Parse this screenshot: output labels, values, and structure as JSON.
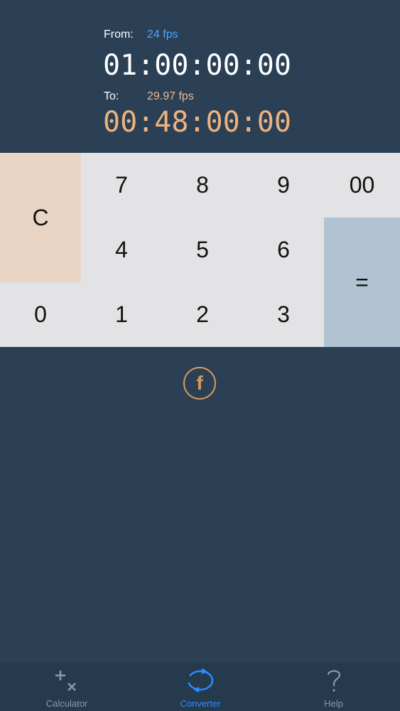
{
  "header": {
    "from_label": "From:",
    "from_fps": "24 fps",
    "from_timecode": "01:00:00:00",
    "to_label": "To:",
    "to_fps": "29.97 fps",
    "to_timecode": "00:48:00:00"
  },
  "keypad": {
    "clear": "C",
    "seven": "7",
    "eight": "8",
    "nine": "9",
    "double_zero": "00",
    "four": "4",
    "five": "5",
    "six": "6",
    "equals": "=",
    "zero": "0",
    "one": "1",
    "two": "2",
    "three": "3"
  },
  "share": {
    "icon": "facebook-icon",
    "glyph": "f"
  },
  "tabbar": {
    "tabs": [
      {
        "label": "Calculator",
        "icon": "plus-times-icon",
        "active": false
      },
      {
        "label": "Converter",
        "icon": "refresh-cycle-icon",
        "active": true
      },
      {
        "label": "Help",
        "icon": "question-mark-icon",
        "active": false
      }
    ]
  },
  "colors": {
    "background": "#2b4055",
    "from_fps": "#4da3ff",
    "to_timecode": "#efb27f",
    "keypad_bg": "#e3e3e5",
    "clear_key": "#ead5c4",
    "equals_key": "#b1c3d2",
    "active_tab": "#2a8cff"
  }
}
